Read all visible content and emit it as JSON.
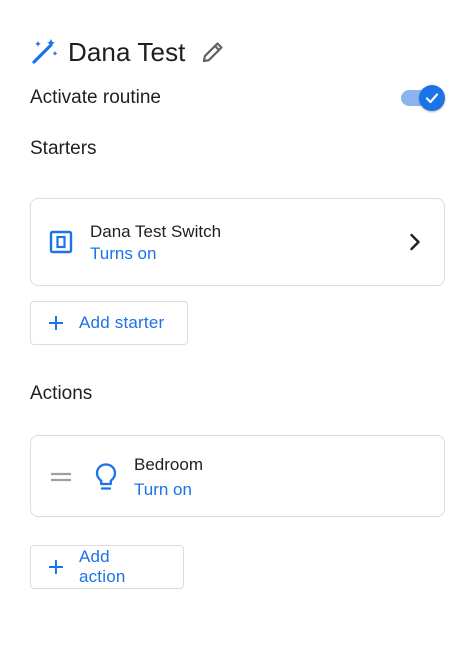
{
  "routine": {
    "title": "Dana Test",
    "activate_label": "Activate routine",
    "activated": true
  },
  "starters": {
    "section_title": "Starters",
    "items": [
      {
        "name": "Dana Test Switch",
        "detail": "Turns on",
        "icon": "switch-icon"
      }
    ],
    "add_label": "Add starter"
  },
  "actions": {
    "section_title": "Actions",
    "items": [
      {
        "name": "Bedroom",
        "detail": "Turn on",
        "icon": "lightbulb-icon"
      }
    ],
    "add_label": "Add action"
  },
  "colors": {
    "accent": "#1a73e8",
    "toggle_track": "#8fb3f0",
    "border": "#dadce0",
    "text": "#1f1f1f"
  }
}
